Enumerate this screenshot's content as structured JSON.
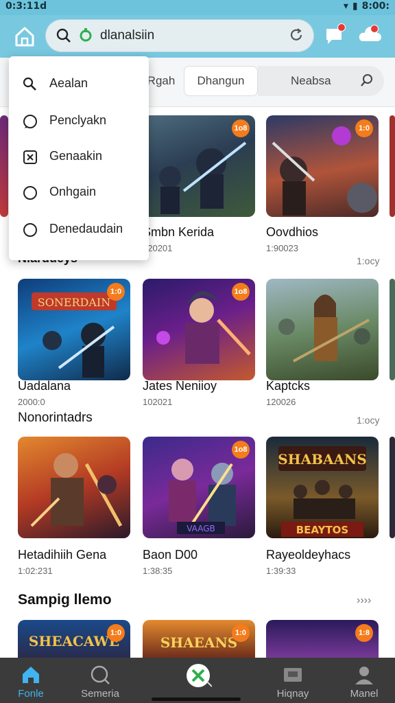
{
  "status": {
    "time": "0:3:11d",
    "battery": "8:00:"
  },
  "search": {
    "query": "dlanalsiin"
  },
  "menu": {
    "items": [
      {
        "label": "Aealan",
        "icon": "search-icon"
      },
      {
        "label": "Penclyakn",
        "icon": "chat-bubble-icon"
      },
      {
        "label": "Genaakin",
        "icon": "game-controller-icon"
      },
      {
        "label": "Onhgain",
        "icon": "circle-icon"
      },
      {
        "label": "Denedaudain",
        "icon": "circle-icon"
      }
    ]
  },
  "filters": {
    "chip_a": "Rgah",
    "chip_b": "Dhangun",
    "chip_c": "Neabsa"
  },
  "sections": [
    {
      "title": "Niardueys",
      "more": "1:ocy",
      "cards": [
        {
          "title": "",
          "sub": "",
          "tag": ""
        },
        {
          "title": "Smbn Kerida",
          "sub": "120201",
          "tag": "1o8"
        },
        {
          "title": "Oovdhios",
          "sub": "1:90023",
          "tag": "1:0"
        }
      ]
    },
    {
      "title": "",
      "more": "",
      "cards": [
        {
          "title": "Uadalana",
          "sub": "2000:0",
          "tag": "1:0"
        },
        {
          "title": "Jates Neniioy",
          "sub": "102021",
          "tag": "1o8"
        },
        {
          "title": "Kaptcks",
          "sub": "120026",
          "tag": ""
        }
      ]
    },
    {
      "title": "Nonorintadrs",
      "more": "1:ocy",
      "cards": [
        {
          "title": "Hetadihiih Gena",
          "sub": "1:02:231",
          "tag": ""
        },
        {
          "title": "Baon D00",
          "sub": "1:38:35",
          "tag": "1o8"
        },
        {
          "title": "Rayeoldeyhacs",
          "sub": "1:39:33",
          "tag": ""
        }
      ]
    },
    {
      "title": "Sampig llemo",
      "more": "››››",
      "cards": [
        {
          "title": "",
          "sub": "",
          "tag": "1:0"
        },
        {
          "title": "",
          "sub": "",
          "tag": "1:0"
        },
        {
          "title": "",
          "sub": "",
          "tag": "1:8"
        }
      ]
    }
  ],
  "nav": {
    "home": "Fonle",
    "search": "Semeria",
    "center": "",
    "history": "Hiqnay",
    "profile": "Manel"
  },
  "colors": {
    "appbar": "#78c8e0",
    "accent": "#3fb4f0",
    "tag": "#f47c1c",
    "navbar": "#3b3b3b"
  }
}
